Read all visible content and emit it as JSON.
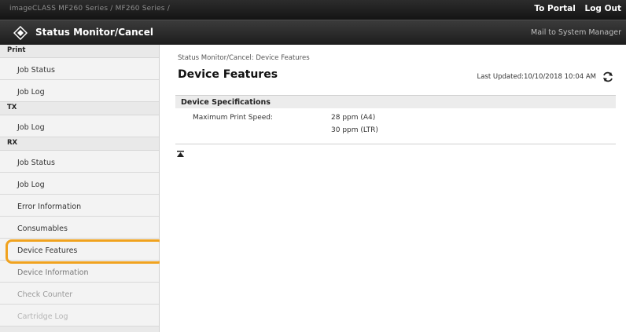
{
  "topbar": {
    "breadcrumb": "imageCLASS   MF260 Series / MF260 Series /",
    "to_portal": "To Portal",
    "log_out": "Log Out"
  },
  "titlebar": {
    "title": "Status Monitor/Cancel",
    "mail": "Mail to System Manager"
  },
  "sidebar": {
    "print": {
      "heading": "Print",
      "items": [
        "Job Status",
        "Job Log"
      ]
    },
    "tx": {
      "heading": "TX",
      "items": [
        "Job Log"
      ]
    },
    "rx": {
      "heading": "RX",
      "items": [
        "Job Status",
        "Job Log",
        "Error Information",
        "Consumables",
        "Device Features",
        "Device Information",
        "Check Counter",
        "Cartridge Log"
      ]
    },
    "active_item": "Device Features"
  },
  "main": {
    "breadcrumb": "Status Monitor/Cancel: Device Features",
    "title": "Device Features",
    "last_updated": "Last Updated:10/10/2018 10:04 AM",
    "section_heading": "Device Specifications",
    "spec_label": "Maximum Print Speed:",
    "spec_value_a4": "28 ppm (A4)",
    "spec_value_ltr": "30 ppm (LTR)"
  },
  "colors": {
    "highlight": "#f0a21e",
    "header_dark": "#1d1d1d",
    "sidebar_bg": "#e9e9e9"
  }
}
